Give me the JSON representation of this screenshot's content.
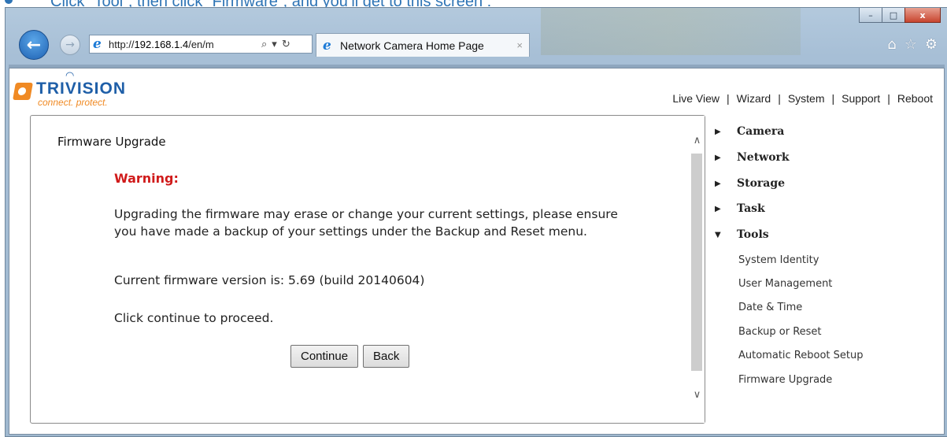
{
  "caption": {
    "text": "Click “Tool”, then click “Firmware”, and you’ll get to this screen :"
  },
  "browser": {
    "url_prefix": "http://",
    "url_host": "192.168.1.4",
    "url_suffix": "/en/m",
    "tab_title": "Network Camera Home Page",
    "tab_close": "×",
    "window_buttons": [
      "–",
      "□",
      "x"
    ],
    "tool_icons": [
      "home-icon",
      "star-icon",
      "gear-icon"
    ]
  },
  "site": {
    "brand": "TRIVISION",
    "tagline": "connect. protect.",
    "nav": [
      "Live View",
      "Wizard",
      "System",
      "Support",
      "Reboot"
    ],
    "nav_separator": "|"
  },
  "content": {
    "title": "Firmware Upgrade",
    "warning": "Warning:",
    "message": "Upgrading the firmware may erase or change your current settings, please ensure you have made a backup of your settings under the Backup and Reset menu.",
    "version_text": "Current firmware version is: 5.69 (build 20140604)",
    "proceed_text": "Click continue to proceed.",
    "continue_label": "Continue",
    "back_label": "Back"
  },
  "menu": {
    "sections": [
      {
        "label": "Camera",
        "expanded": false
      },
      {
        "label": "Network",
        "expanded": false
      },
      {
        "label": "Storage",
        "expanded": false
      },
      {
        "label": "Task",
        "expanded": false
      },
      {
        "label": "Tools",
        "expanded": true
      }
    ],
    "tools_items": [
      "System Identity",
      "User Management",
      "Date & Time",
      "Backup or Reset",
      "Automatic Reboot Setup",
      "Firmware Upgrade"
    ]
  },
  "colors": {
    "warning": "#d01b1b",
    "brand_blue": "#1f5fa8",
    "brand_orange": "#f08a24",
    "caption": "#2e74b5"
  }
}
